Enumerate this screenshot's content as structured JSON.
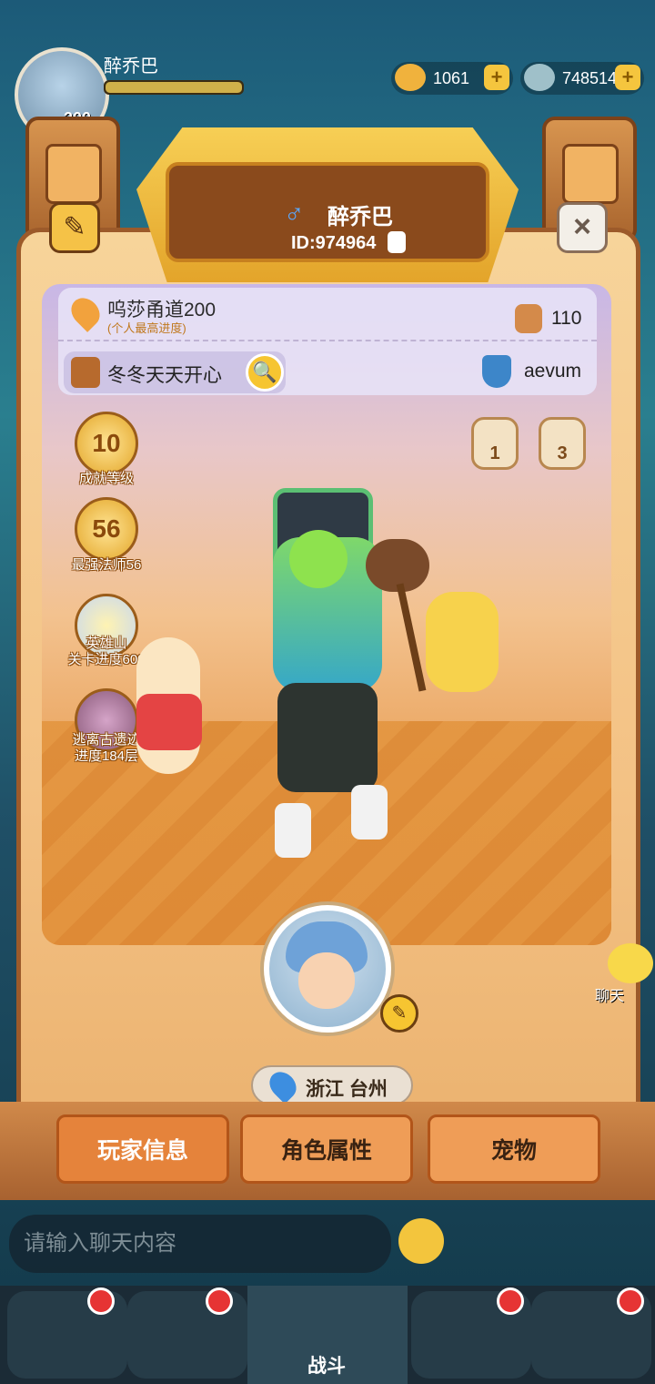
{
  "top_bar": {
    "player_name": "醉乔巴",
    "level": "200",
    "currency_gold": "1061",
    "currency_shell": "748514",
    "plus_label": "+",
    "icons": [
      "skull-icon",
      "gold-coin-icon",
      "shell-icon"
    ]
  },
  "profile": {
    "gender_symbol": "♂",
    "name": "醉乔巴",
    "id_text": "ID:974964",
    "edit_icon": "edit-icon",
    "close_label": "×"
  },
  "info": {
    "progress_title": "呜莎甬道200",
    "progress_sub": "(个人最高进度)",
    "likes": "110",
    "guild_name": "冬冬天天开心",
    "search_glyph": "🔍",
    "alliance_name": "aevum"
  },
  "badges": [
    {
      "value": "10",
      "label": "成就等级"
    },
    {
      "value": "56",
      "label": "最强法师56"
    },
    {
      "value": "",
      "label": "英雄山\n关卡进度600"
    },
    {
      "value": "",
      "label": "逃离古遗迹\n进度184层"
    }
  ],
  "rank_badges": [
    {
      "value": "1"
    },
    {
      "value": "3"
    }
  ],
  "avatar": {
    "pencil_glyph": "✎"
  },
  "location": {
    "region": "浙江 台州"
  },
  "tabs": [
    {
      "label": "玩家信息",
      "active": true
    },
    {
      "label": "角色属性",
      "active": false
    },
    {
      "label": "宠物",
      "active": false
    }
  ],
  "chat": {
    "side_label": "聊天",
    "input_placeholder": "请输入聊天内容"
  },
  "nav": {
    "battle_label": "战斗"
  },
  "colors": {
    "accent_gold": "#f5c247",
    "panel": "#f3c184",
    "tab_active": "#e5833b",
    "notify_red": "#e63434"
  }
}
